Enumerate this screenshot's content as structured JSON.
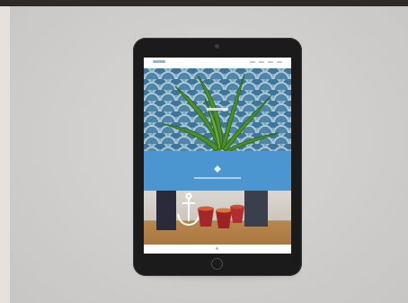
{
  "scene": {
    "subject": "tablet-mockup",
    "colors": {
      "background": "#d2d0ce",
      "device": "#1b1b1c",
      "accent_band": "#4b95d1",
      "tile_pattern": "#7aa6be"
    },
    "icons": [
      "camera-icon",
      "home-button-icon",
      "anchor-icon"
    ]
  }
}
